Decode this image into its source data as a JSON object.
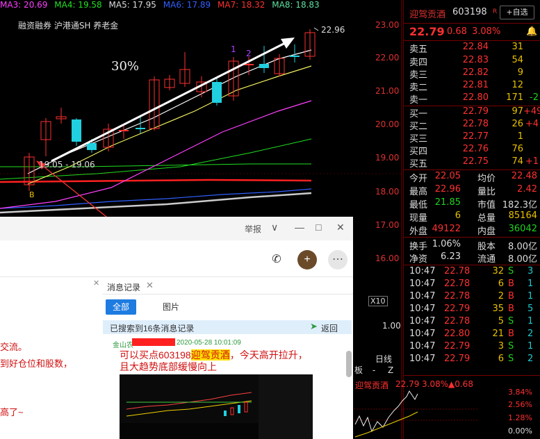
{
  "ma_bar": [
    {
      "label": "MA3: 20.69",
      "color": "#ff40ff"
    },
    {
      "label": "MA4: 19.58",
      "color": "#20e020"
    },
    {
      "label": "MA5: 17.95",
      "color": "#dddddd"
    },
    {
      "label": "MA6: 17.89",
      "color": "#3060ff"
    },
    {
      "label": "MA7: 18.32",
      "color": "#ff3030"
    },
    {
      "label": "MA8: 18.83",
      "color": "#60e0a0"
    }
  ],
  "tags": "融资融券 沪港通SH 养老金",
  "annotation_pct": "30%",
  "price_axis": [
    "23.00",
    "22.00",
    "21.00",
    "20.00",
    "19.00",
    "18.00",
    "17.00",
    "16.00"
  ],
  "high_label": "22.96",
  "range_label": "19.05 - 19.06",
  "mark_b": "B",
  "marks": [
    "1",
    "2"
  ],
  "volume_axis": {
    "x10": "X10",
    "v1": "1.00"
  },
  "daily_label": "日线",
  "mini_toolbar": [
    "板",
    "-",
    "Z"
  ],
  "quote": {
    "name": "迎驾贡酒",
    "code": "603198",
    "badge": "R",
    "watch_btn": "+自选",
    "price": "22.79",
    "change": "0.68",
    "change_pct": "3.08%"
  },
  "sell": [
    {
      "label": "卖五",
      "price": "22.84",
      "vol": "31",
      "delta": ""
    },
    {
      "label": "卖四",
      "price": "22.83",
      "vol": "54",
      "delta": ""
    },
    {
      "label": "卖三",
      "price": "22.82",
      "vol": "9",
      "delta": ""
    },
    {
      "label": "卖二",
      "price": "22.81",
      "vol": "12",
      "delta": ""
    },
    {
      "label": "卖一",
      "price": "22.80",
      "vol": "171",
      "delta": "-2"
    }
  ],
  "buy": [
    {
      "label": "买一",
      "price": "22.79",
      "vol": "97",
      "delta": "+49"
    },
    {
      "label": "买二",
      "price": "22.78",
      "vol": "26",
      "delta": "+4"
    },
    {
      "label": "买三",
      "price": "22.77",
      "vol": "1",
      "delta": ""
    },
    {
      "label": "买四",
      "price": "22.76",
      "vol": "76",
      "delta": ""
    },
    {
      "label": "买五",
      "price": "22.75",
      "vol": "74",
      "delta": "+1"
    }
  ],
  "stats": [
    {
      "k1": "今开",
      "v1": "22.05",
      "c1": "r",
      "k2": "均价",
      "v2": "22.48",
      "c2": "r"
    },
    {
      "k1": "最高",
      "v1": "22.96",
      "c1": "r",
      "k2": "量比",
      "v2": "2.42",
      "c2": "r"
    },
    {
      "k1": "最低",
      "v1": "21.85",
      "c1": "g",
      "k2": "市值",
      "v2": "182.3亿",
      "c2": "w"
    },
    {
      "k1": "现量",
      "v1": "6",
      "c1": "y",
      "k2": "总量",
      "v2": "85164",
      "c2": "y"
    },
    {
      "k1": "外盘",
      "v1": "49122",
      "c1": "r",
      "k2": "内盘",
      "v2": "36042",
      "c2": "g"
    }
  ],
  "stats2": [
    {
      "k1": "换手",
      "v1": "1.06%",
      "c1": "w",
      "k2": "股本",
      "v2": "8.00亿",
      "c2": "w"
    },
    {
      "k1": "净资",
      "v1": "6.23",
      "c1": "w",
      "k2": "流通",
      "v2": "8.00亿",
      "c2": "w"
    }
  ],
  "ticks": [
    {
      "t": "10:47",
      "p": "22.78",
      "v": "32",
      "s": "S",
      "n": "3"
    },
    {
      "t": "10:47",
      "p": "22.78",
      "v": "6",
      "s": "B",
      "n": "1"
    },
    {
      "t": "10:47",
      "p": "22.78",
      "v": "2",
      "s": "B",
      "n": "1"
    },
    {
      "t": "10:47",
      "p": "22.79",
      "v": "35",
      "s": "B",
      "n": "5"
    },
    {
      "t": "10:47",
      "p": "22.78",
      "v": "5",
      "s": "S",
      "n": "1"
    },
    {
      "t": "10:47",
      "p": "22.80",
      "v": "21",
      "s": "B",
      "n": "2"
    },
    {
      "t": "10:47",
      "p": "22.79",
      "v": "3",
      "s": "S",
      "n": "1"
    },
    {
      "t": "10:47",
      "p": "22.79",
      "v": "6",
      "s": "S",
      "n": "2"
    }
  ],
  "mini_chart": {
    "name": "迎驾贡酒",
    "price": "22.79",
    "pct": "3.08%",
    "chg": "▲0.68",
    "scale": [
      "3.84%",
      "2.56%",
      "1.28%",
      "0.00%"
    ]
  },
  "chat": {
    "report": "举报",
    "left_lines": [
      "交流。",
      "到好仓位和股数，",
      "高了~"
    ],
    "tab_label": "消息记录",
    "btn_all": "全部",
    "btn_pic": "图片",
    "search_result": "已搜索到16条消息记录",
    "back": "返回",
    "sender": "金山农",
    "time": "2020-05-28 10:01:09",
    "msg_pre": "可以买点603198",
    "msg_hl": "迎驾贡酒",
    "msg_post": "，今天高开拉升，且大趋势底部缓慢向上"
  }
}
